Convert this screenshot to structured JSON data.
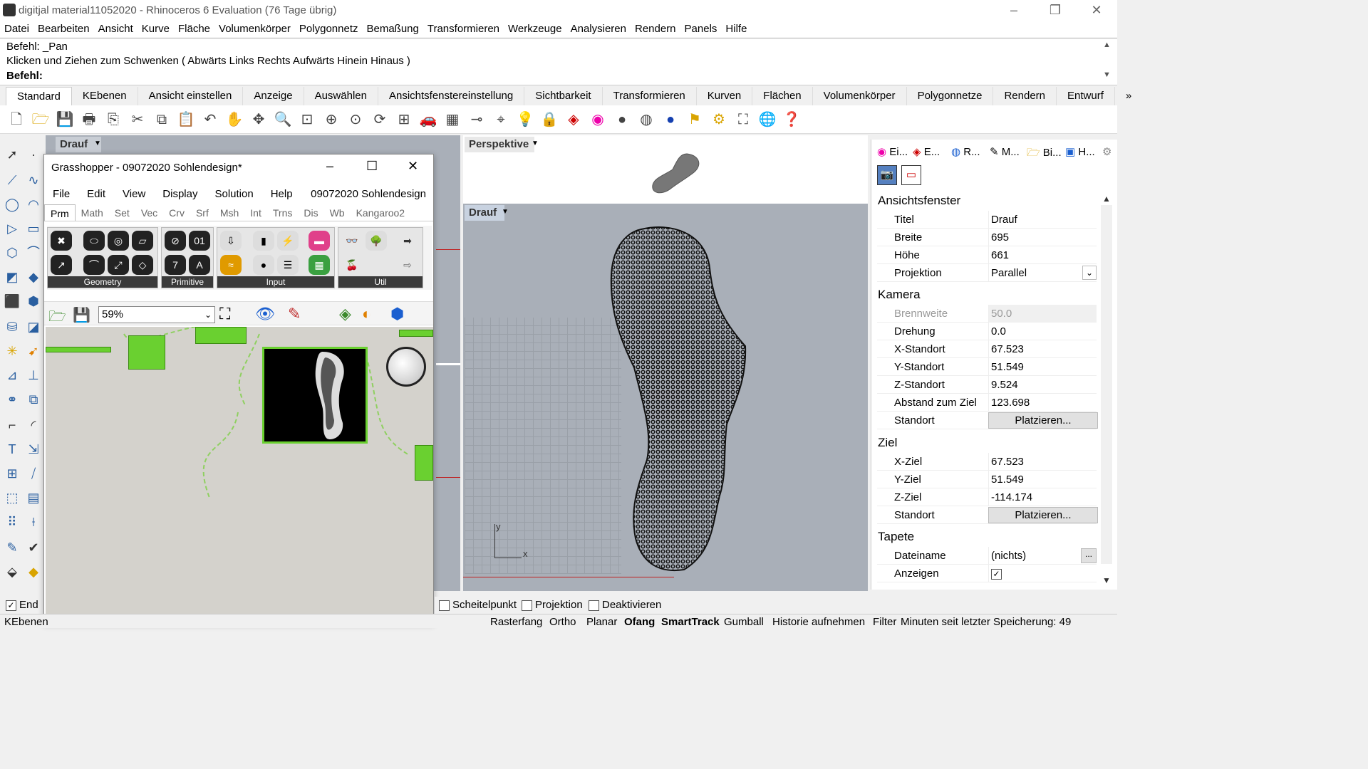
{
  "window": {
    "title": "digitjal material11052020 - Rhinoceros 6 Evaluation (76 Tage übrig)"
  },
  "menu": [
    "Datei",
    "Bearbeiten",
    "Ansicht",
    "Kurve",
    "Fläche",
    "Volumenkörper",
    "Polygonnetz",
    "Bemaßung",
    "Transformieren",
    "Werkzeuge",
    "Analysieren",
    "Rendern",
    "Panels",
    "Hilfe"
  ],
  "command": {
    "history1": "Befehl: _Pan",
    "history2": "Klicken und Ziehen zum Schwenken ( Abwärts  Links  Rechts  Aufwärts  Hinein  Hinaus )",
    "prompt": "Befehl:"
  },
  "tabs": [
    "Standard",
    "KEbenen",
    "Ansicht einstellen",
    "Anzeige",
    "Auswählen",
    "Ansichtsfenstereinstellung",
    "Sichtbarkeit",
    "Transformieren",
    "Kurven",
    "Flächen",
    "Volumenkörper",
    "Polygonnetze",
    "Rendern",
    "Entwurf"
  ],
  "tabs_more": "»",
  "viewports": {
    "top_left": "Drauf",
    "top_right": "Perspektive",
    "bottom_right": "Drauf",
    "axis_y": "y",
    "axis_x": "x"
  },
  "grasshopper": {
    "title": "Grasshopper - 09072020 Sohlendesign*",
    "menu": [
      "File",
      "Edit",
      "View",
      "Display",
      "Solution",
      "Help"
    ],
    "doc_name": "09072020 Sohlendesign",
    "tabs": [
      "Prm",
      "Math",
      "Set",
      "Vec",
      "Crv",
      "Srf",
      "Msh",
      "Int",
      "Trns",
      "Dis",
      "Wb",
      "Kangaroo2"
    ],
    "groups": {
      "geometry": "Geometry",
      "primitive": "Primitive",
      "input": "Input",
      "util": "Util"
    },
    "zoom": "59%"
  },
  "properties": {
    "tabs": [
      "Ei...",
      "E...",
      "R...",
      "M...",
      "Bi...",
      "H..."
    ],
    "sections": {
      "viewport": "Ansichtsfenster",
      "camera": "Kamera",
      "target": "Ziel",
      "wallpaper": "Tapete"
    },
    "rows": {
      "titel": {
        "k": "Titel",
        "v": "Drauf"
      },
      "breite": {
        "k": "Breite",
        "v": "695"
      },
      "hoehe": {
        "k": "Höhe",
        "v": "661"
      },
      "projektion": {
        "k": "Projektion",
        "v": "Parallel"
      },
      "brennweite": {
        "k": "Brennweite",
        "v": "50.0"
      },
      "drehung": {
        "k": "Drehung",
        "v": "0.0"
      },
      "xstandort": {
        "k": "X-Standort",
        "v": "67.523"
      },
      "ystandort": {
        "k": "Y-Standort",
        "v": "51.549"
      },
      "zstandort": {
        "k": "Z-Standort",
        "v": "9.524"
      },
      "abstand": {
        "k": "Abstand zum Ziel",
        "v": "123.698"
      },
      "standort1": {
        "k": "Standort",
        "v": "Platzieren..."
      },
      "xziel": {
        "k": "X-Ziel",
        "v": "67.523"
      },
      "yziel": {
        "k": "Y-Ziel",
        "v": "51.549"
      },
      "zziel": {
        "k": "Z-Ziel",
        "v": "-114.174"
      },
      "standort2": {
        "k": "Standort",
        "v": "Platzieren..."
      },
      "dateiname": {
        "k": "Dateiname",
        "v": "(nichts)"
      },
      "anzeigen": {
        "k": "Anzeigen",
        "v": ""
      }
    },
    "browse": "..."
  },
  "osnap": {
    "end": "End",
    "scheitel": "Scheitelpunkt",
    "projektion": "Projektion",
    "deaktivieren": "Deaktivieren"
  },
  "status": {
    "layer": "KEbenen",
    "items": [
      "Rasterfang",
      "Ortho",
      "Planar",
      "Ofang",
      "SmartTrack",
      "Gumball",
      "Historie aufnehmen",
      "Filter"
    ],
    "save": "Minuten seit letzter Speicherung: 49"
  }
}
